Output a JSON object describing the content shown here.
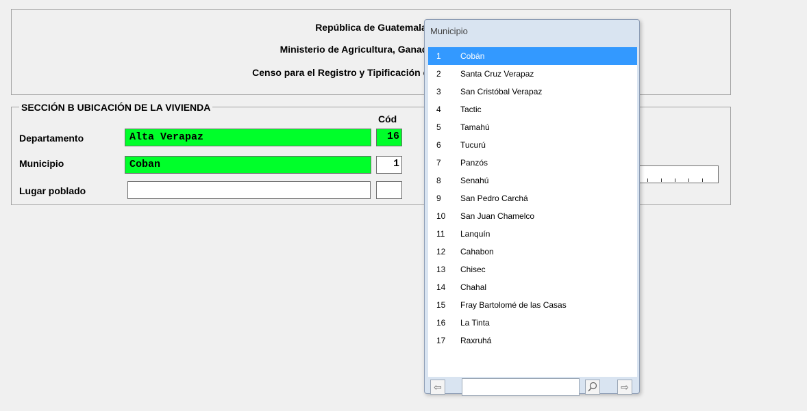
{
  "header": {
    "line1": "República de Guatemala",
    "line2": "Ministerio de Agricultura, Ganadería y A",
    "line3": "Censo para el Registro y Tipificación de Familias qu"
  },
  "section": {
    "title": "SECCIÓN B UBICACIÓN DE LA VIVIENDA",
    "cod_label": "Cód",
    "fields": [
      {
        "label": "Departamento",
        "value": "Alta Verapaz",
        "code": "16"
      },
      {
        "label": "Municipio",
        "value": "Coban",
        "code": "1"
      },
      {
        "label": "Lugar poblado",
        "value": "",
        "code": ""
      }
    ]
  },
  "popup": {
    "title": "Municipio",
    "selected_index": 0,
    "items": [
      {
        "num": "1",
        "name": "Cobán"
      },
      {
        "num": "2",
        "name": "Santa Cruz Verapaz"
      },
      {
        "num": "3",
        "name": "San Cristóbal Verapaz"
      },
      {
        "num": "4",
        "name": "Tactic"
      },
      {
        "num": "5",
        "name": "Tamahú"
      },
      {
        "num": "6",
        "name": "Tucurú"
      },
      {
        "num": "7",
        "name": "Panzós"
      },
      {
        "num": "8",
        "name": "Senahú"
      },
      {
        "num": "9",
        "name": "San Pedro Carchá"
      },
      {
        "num": "10",
        "name": "San Juan Chamelco"
      },
      {
        "num": "11",
        "name": "Lanquín"
      },
      {
        "num": "12",
        "name": "Cahabon"
      },
      {
        "num": "13",
        "name": "Chisec"
      },
      {
        "num": "14",
        "name": "Chahal"
      },
      {
        "num": "15",
        "name": "Fray Bartolomé de las Casas"
      },
      {
        "num": "16",
        "name": "La Tinta"
      },
      {
        "num": "17",
        "name": "Raxruhá"
      }
    ],
    "search_value": "",
    "icons": {
      "prev": "arrow-left-icon",
      "search": "search-icon",
      "next": "arrow-right-icon"
    }
  },
  "colors": {
    "field_green": "#00ff2a",
    "selection_blue": "#3399ff",
    "popup_frame": "#d9e4f1"
  }
}
